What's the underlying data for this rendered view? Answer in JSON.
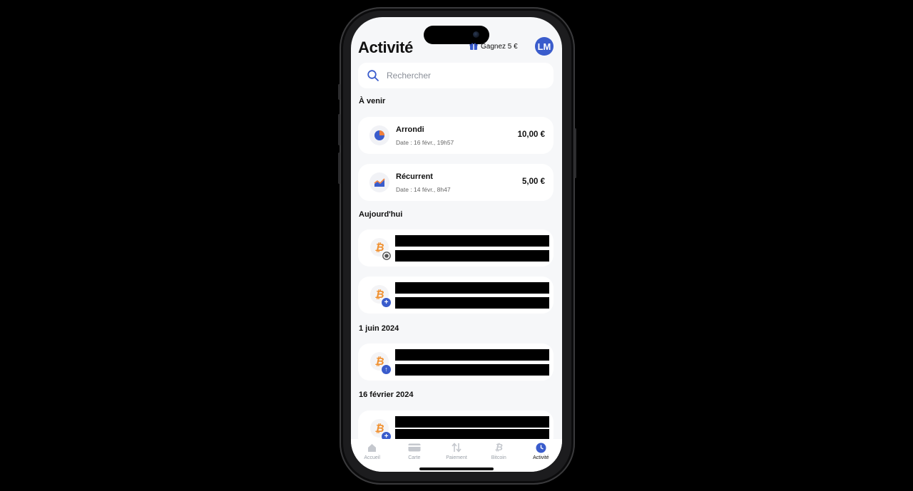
{
  "header": {
    "title": "Activité",
    "gift_label": "Gagnez 5 €",
    "avatar_initials": "LM"
  },
  "search": {
    "placeholder": "Rechercher"
  },
  "sections": {
    "upcoming": "À venir",
    "today": "Aujourd'hui",
    "june": "1 juin 2024",
    "february": "16 février 2024"
  },
  "upcoming_items": [
    {
      "name": "Arrondi",
      "date": "Date : 16 févr., 19h57",
      "amount": "10,00 €",
      "icon": "pie-chart-icon"
    },
    {
      "name": "Récurrent",
      "date": "Date : 14 févr., 8h47",
      "amount": "5,00 €",
      "icon": "trend-chart-icon"
    }
  ],
  "transactions": [
    {
      "icon": "bitcoin-icon",
      "badge": "pending-badge-icon"
    },
    {
      "icon": "bitcoin-icon",
      "badge": "plus-badge-icon"
    },
    {
      "icon": "bitcoin-icon",
      "badge": "arrow-up-badge-icon"
    },
    {
      "icon": "bitcoin-icon",
      "badge": "plus-badge-icon"
    }
  ],
  "tabs": [
    {
      "label": "Accueil",
      "icon": "home-icon"
    },
    {
      "label": "Carte",
      "icon": "card-icon"
    },
    {
      "label": "Paiement",
      "icon": "transfer-icon"
    },
    {
      "label": "Bitcoin",
      "icon": "bitcoin-icon"
    },
    {
      "label": "Activité",
      "icon": "clock-icon",
      "active": true
    }
  ],
  "colors": {
    "accent": "#3a5ccc",
    "bitcoin": "#f0902f",
    "background": "#f6f7f9"
  }
}
